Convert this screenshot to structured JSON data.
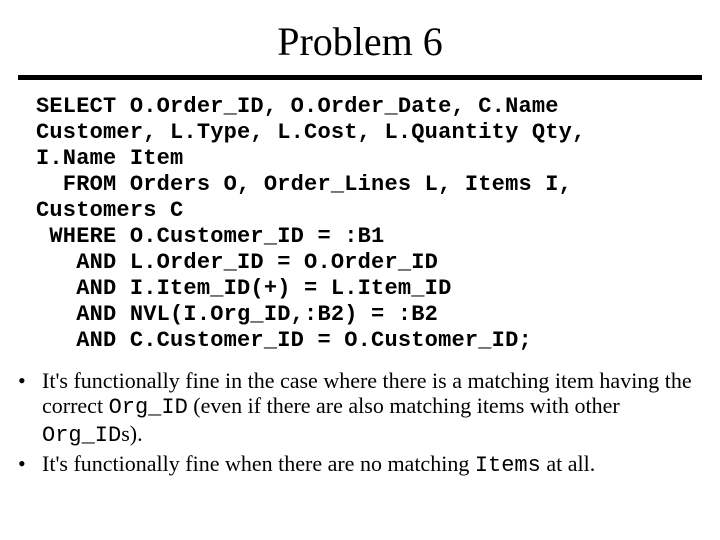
{
  "title": "Problem 6",
  "code": "SELECT O.Order_ID, O.Order_Date, C.Name\nCustomer, L.Type, L.Cost, L.Quantity Qty,\nI.Name Item\n  FROM Orders O, Order_Lines L, Items I,\nCustomers C\n WHERE O.Customer_ID = :B1\n   AND L.Order_ID = O.Order_ID\n   AND I.Item_ID(+) = L.Item_ID\n   AND NVL(I.Org_ID,:B2) = :B2\n   AND C.Customer_ID = O.Customer_ID;",
  "bullets": {
    "b1": {
      "a": "It's functionally fine in the case where there is a matching item having the correct ",
      "code1": "Org_ID",
      "b": " (even if there are also matching items with other ",
      "code2": "Org_ID",
      "c": "s)."
    },
    "b2": {
      "a": "It's functionally fine when there are no matching ",
      "code1": "Items",
      "b": " at all."
    }
  }
}
